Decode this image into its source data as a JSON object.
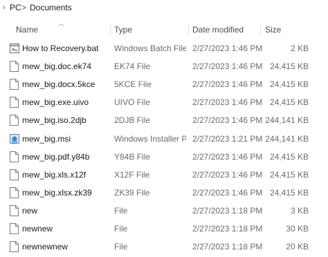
{
  "breadcrumb": {
    "items": [
      "PC",
      "Documents"
    ],
    "separator": ">"
  },
  "columns": {
    "name": "Name",
    "type": "Type",
    "date_modified": "Date modified",
    "size": "Size",
    "sort_icon": "chevron-up-icon"
  },
  "files": [
    {
      "name": "How to Recovery.bat",
      "type": "Windows Batch File",
      "date": "2/27/2023 1:46 PM",
      "size": "2 KB",
      "icon": "batch-file-icon"
    },
    {
      "name": "mew_big.doc.ek74",
      "type": "EK74 File",
      "date": "2/27/2023 1:46 PM",
      "size": "24,415 KB",
      "icon": "file-icon"
    },
    {
      "name": "mew_big.docx.5kce",
      "type": "5KCE File",
      "date": "2/27/2023 1:46 PM",
      "size": "24,415 KB",
      "icon": "file-icon"
    },
    {
      "name": "mew_big.exe.uivo",
      "type": "UIVO File",
      "date": "2/27/2023 1:46 PM",
      "size": "24,415 KB",
      "icon": "file-icon"
    },
    {
      "name": "mew_big.iso.2djb",
      "type": "2DJB File",
      "date": "2/27/2023 1:46 PM",
      "size": "244,141 KB",
      "icon": "file-icon"
    },
    {
      "name": "mew_big.msi",
      "type": "Windows Installer Pa...",
      "date": "2/27/2023 1:21 PM",
      "size": "244,141 KB",
      "icon": "installer-icon"
    },
    {
      "name": "mew_big.pdf.y84b",
      "type": "Y84B File",
      "date": "2/27/2023 1:46 PM",
      "size": "24,415 KB",
      "icon": "file-icon"
    },
    {
      "name": "mew_big.xls.x12f",
      "type": "X12F File",
      "date": "2/27/2023 1:46 PM",
      "size": "24,415 KB",
      "icon": "file-icon"
    },
    {
      "name": "mew_big.xlsx.zk39",
      "type": "ZK39 File",
      "date": "2/27/2023 1:46 PM",
      "size": "24,415 KB",
      "icon": "file-icon"
    },
    {
      "name": "new",
      "type": "File",
      "date": "2/27/2023 1:18 PM",
      "size": "3 KB",
      "icon": "file-icon"
    },
    {
      "name": "newnew",
      "type": "File",
      "date": "2/27/2023 1:18 PM",
      "size": "30 KB",
      "icon": "file-icon"
    },
    {
      "name": "newnewnew",
      "type": "File",
      "date": "2/27/2023 1:18 PM",
      "size": "20 KB",
      "icon": "file-icon"
    }
  ]
}
